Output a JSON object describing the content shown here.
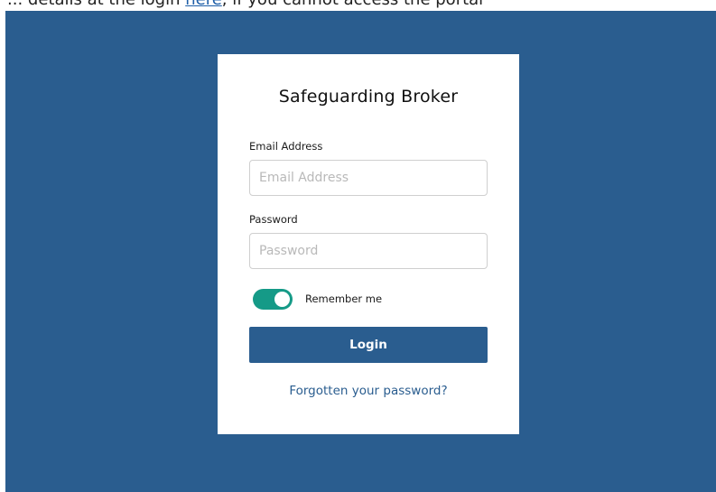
{
  "header_fragment": {
    "before": "... details at the login ",
    "link": "here",
    "after": ", if you cannot access the portal"
  },
  "colors": {
    "stage_background": "#2a5d8f",
    "card_background": "#ffffff",
    "accent_button": "#2a5d8f",
    "toggle_on": "#159a87",
    "link": "#2a5d8f"
  },
  "login_form": {
    "title": "Safeguarding Broker",
    "email": {
      "label": "Email Address",
      "placeholder": "Email Address",
      "value": ""
    },
    "password": {
      "label": "Password",
      "placeholder": "Password",
      "value": ""
    },
    "remember_me": {
      "label": "Remember me",
      "checked": true
    },
    "login_button": "Login",
    "forgot_password": "Forgotten your password?"
  }
}
